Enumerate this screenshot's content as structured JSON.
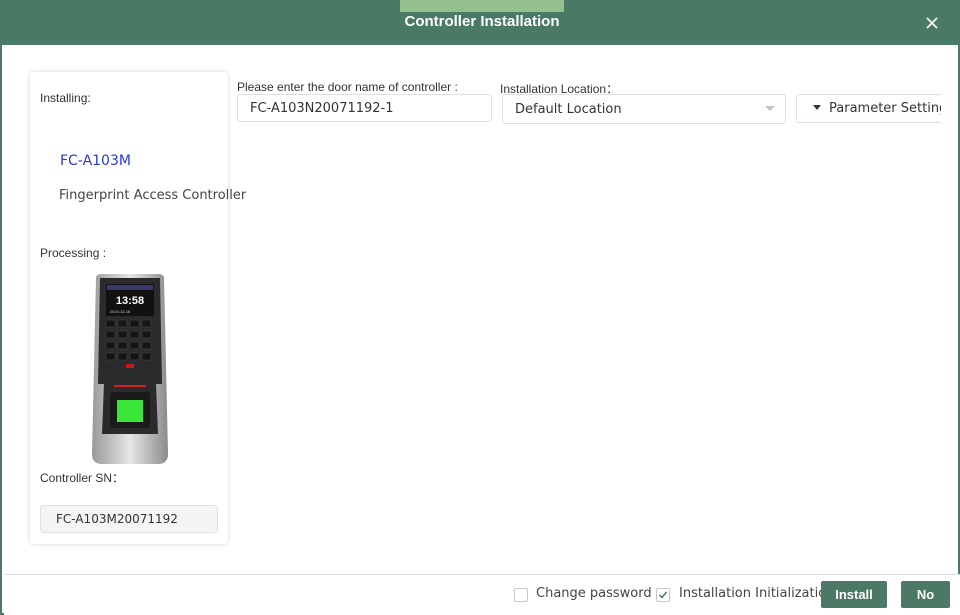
{
  "window": {
    "title": "Controller Installation",
    "accent_color": "#4a7a66",
    "tab_accent_color": "#94c08d"
  },
  "left_panel": {
    "installing_label": "Installing:",
    "model": "FC-A103M",
    "model_description": "Fingerprint Access Controller",
    "processing_label": "Processing :",
    "device_screen_time": "13:58",
    "device_screen_date": "2019-12-16",
    "controller_sn_label": "Controller SN：",
    "controller_sn": "FC-A103M20071192"
  },
  "form": {
    "door_name_label": "Please enter the door name of controller :",
    "door_name_value": "FC-A103N20071192-1",
    "location_label": "Installation Location：",
    "location_value": "Default Location",
    "parameter_setting_label": "Parameter Setting"
  },
  "footer": {
    "change_password": {
      "label": "Change password",
      "checked": false
    },
    "installation_initialization": {
      "label": "Installation Initialization",
      "checked": true
    },
    "install_button": "Install",
    "no_button": "No"
  }
}
